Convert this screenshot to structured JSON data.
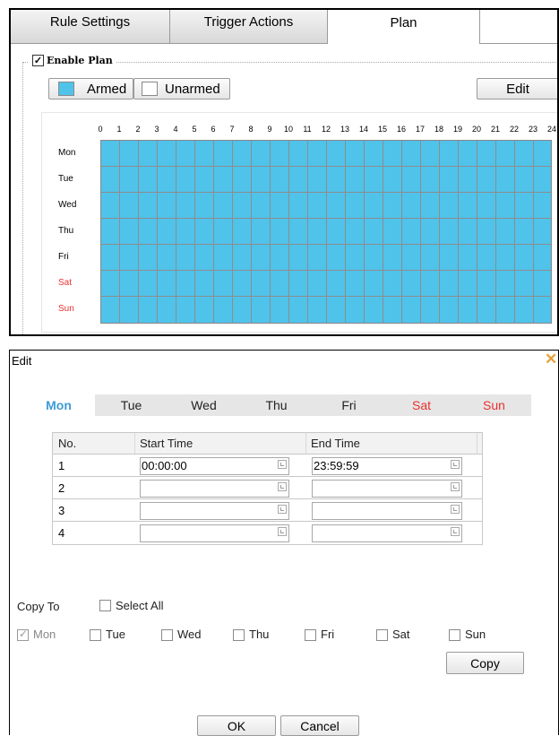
{
  "top_panel": {
    "tabs": [
      {
        "label": "Rule Settings"
      },
      {
        "label": "Trigger Actions"
      },
      {
        "label": "Plan"
      }
    ],
    "active_tab": "Plan",
    "enable_plan": {
      "label": "Enable Plan",
      "checked": true
    },
    "armed_label": "Armed",
    "unarmed_label": "Unarmed",
    "edit_label": "Edit",
    "armed_color": "#4fc3ea",
    "hours": [
      "0",
      "1",
      "2",
      "3",
      "4",
      "5",
      "6",
      "7",
      "8",
      "9",
      "10",
      "11",
      "12",
      "13",
      "14",
      "15",
      "16",
      "17",
      "18",
      "19",
      "20",
      "21",
      "22",
      "23",
      "24"
    ],
    "days": [
      {
        "label": "Mon",
        "weekend": false
      },
      {
        "label": "Tue",
        "weekend": false
      },
      {
        "label": "Wed",
        "weekend": false
      },
      {
        "label": "Thu",
        "weekend": false
      },
      {
        "label": "Fri",
        "weekend": false
      },
      {
        "label": "Sat",
        "weekend": true
      },
      {
        "label": "Sun",
        "weekend": true
      }
    ],
    "all_armed": true
  },
  "edit_dialog": {
    "title": "Edit",
    "day_tabs": [
      {
        "label": "Mon",
        "active": true,
        "weekend": false
      },
      {
        "label": "Tue",
        "active": false,
        "weekend": false
      },
      {
        "label": "Wed",
        "active": false,
        "weekend": false
      },
      {
        "label": "Thu",
        "active": false,
        "weekend": false
      },
      {
        "label": "Fri",
        "active": false,
        "weekend": false
      },
      {
        "label": "Sat",
        "active": false,
        "weekend": true
      },
      {
        "label": "Sun",
        "active": false,
        "weekend": true
      }
    ],
    "table_headers": {
      "no": "No.",
      "start": "Start Time",
      "end": "End Time"
    },
    "rows": [
      {
        "no": "1",
        "start": "00:00:00",
        "end": "23:59:59"
      },
      {
        "no": "2",
        "start": "",
        "end": ""
      },
      {
        "no": "3",
        "start": "",
        "end": ""
      },
      {
        "no": "4",
        "start": "",
        "end": ""
      }
    ],
    "copy_to_label": "Copy To",
    "select_all_label": "Select All",
    "copy_days": [
      {
        "label": "Mon",
        "checked": true
      },
      {
        "label": "Tue",
        "checked": false
      },
      {
        "label": "Wed",
        "checked": false
      },
      {
        "label": "Thu",
        "checked": false
      },
      {
        "label": "Fri",
        "checked": false
      },
      {
        "label": "Sat",
        "checked": false
      },
      {
        "label": "Sun",
        "checked": false
      }
    ],
    "copy_button": "Copy",
    "ok_button": "OK",
    "cancel_button": "Cancel"
  }
}
